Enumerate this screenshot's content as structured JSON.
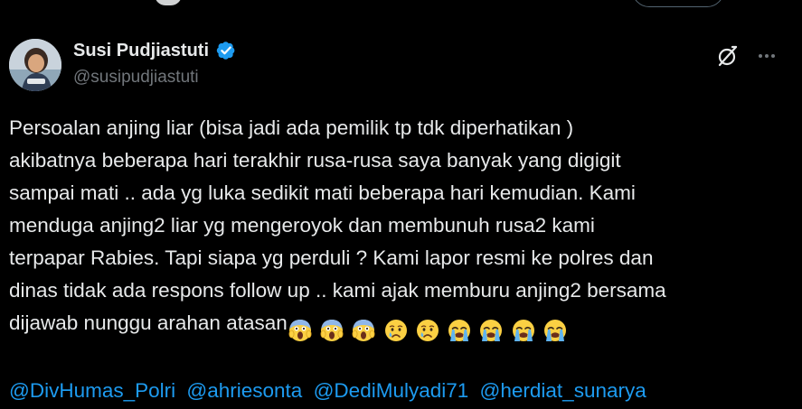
{
  "theme": {
    "background": "#000000",
    "text": "#e7e9ea",
    "secondary_text": "#71767b",
    "link": "#1d9bf0",
    "verified_badge": "#1d9bf0"
  },
  "author": {
    "display_name": "Susi Pudjiastuti",
    "handle": "@susipudjiastuti",
    "verified": true,
    "avatar_icon": "profile-photo"
  },
  "actions": {
    "grok_icon": "grok-icon",
    "more_icon": "more-options-icon"
  },
  "tweet": {
    "lines": [
      "Persoalan anjing liar (bisa jadi ada pemilik tp tdk diperhatikan )",
      "akibatnya beberapa hari terakhir rusa-rusa saya banyak yang digigit",
      "sampai mati .. ada yg luka sedikit mati beberapa hari kemudian. Kami",
      "menduga anjing2 liar yg mengeroyok dan membunuh rusa2 kami",
      "terpapar Rabies. Tapi siapa yg perduli ? Kami lapor resmi ke polres dan",
      "dinas tidak ada respons follow up .. kami ajak memburu anjing2 bersama",
      "dijawab nunggu arahan atasan"
    ],
    "emojis": [
      "screaming-in-fear-emoji",
      "screaming-in-fear-emoji",
      "screaming-in-fear-emoji",
      "crying-face-emoji",
      "crying-face-emoji",
      "loudly-crying-face-emoji",
      "loudly-crying-face-emoji",
      "loudly-crying-face-emoji",
      "loudly-crying-face-emoji"
    ],
    "mentions": [
      "@DivHumas_Polri",
      "@ahriesonta",
      "@DediMulyadi71",
      "@herdiat_sunarya"
    ]
  }
}
